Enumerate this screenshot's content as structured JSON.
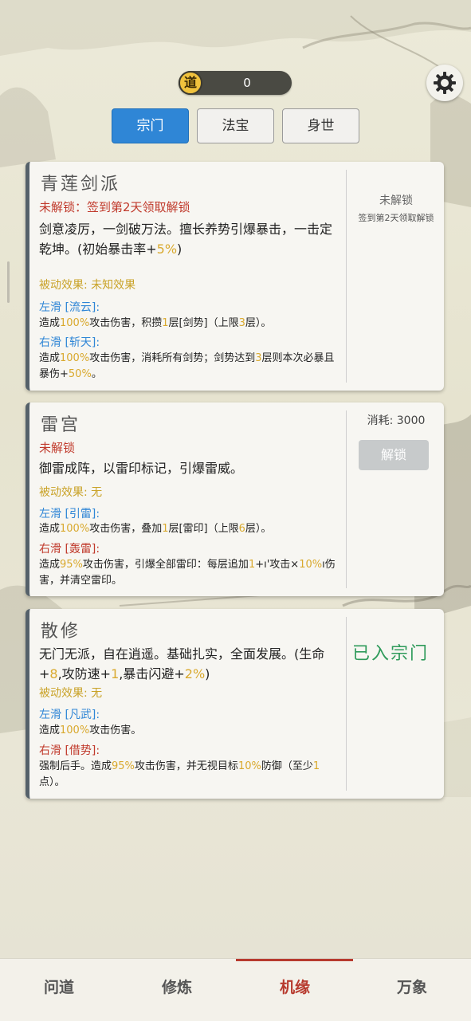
{
  "currency": {
    "icon_label": "道",
    "value": "0"
  },
  "tabs": [
    {
      "label": "宗门",
      "active": true
    },
    {
      "label": "法宝",
      "active": false
    },
    {
      "label": "身世",
      "active": false
    }
  ],
  "cards": [
    {
      "title": "青莲剑派",
      "status": "未解锁：签到第2天领取解锁",
      "desc_parts": [
        "剑意凌厉，一剑破万法。擅长养势引爆暴击，一击定乾坤。(初始暴击率+",
        "5%",
        ")"
      ],
      "passive": "被动效果: 未知效果",
      "left_skill": "左滑 [流云]:",
      "left_parts": [
        "造成",
        "100%",
        "攻击伤害，积攒",
        "1",
        "层[剑势]（上限",
        "3",
        "层）。"
      ],
      "right_skill": "右滑 [斩天]:",
      "right_parts": [
        "造成",
        "100%",
        "攻击伤害，消耗所有剑势；剑势达到",
        "3",
        "层则本次必暴且暴伤+",
        "50%",
        "。"
      ],
      "side_status": "未解锁",
      "side_note": "签到第2天领取解锁"
    },
    {
      "title": "雷宫",
      "status": "未解锁",
      "desc": "御雷成阵，以雷印标记，引爆雷威。",
      "passive": "被动效果: 无",
      "left_skill": "左滑 [引雷]:",
      "left_parts": [
        "造成",
        "100%",
        "攻击伤害，叠加",
        "1",
        "层[雷印]（上限",
        "6",
        "层）。"
      ],
      "right_skill": "右滑 [轰雷]:",
      "right_parts": [
        "造成",
        "95%",
        "攻击伤害，引爆全部雷印：每层追加",
        "1",
        "+ı'攻击×",
        "10%",
        "ı伤害，并清空雷印。"
      ],
      "cost": "消耗: 3000",
      "unlock_button": "解锁"
    },
    {
      "title": "散修",
      "desc_parts": [
        "无门无派，自在逍遥。基础扎实，全面发展。(生命+",
        "8",
        ",攻防速+",
        "1",
        ",暴击闪避+",
        "2%",
        ")"
      ],
      "passive": "被动效果: 无",
      "left_skill": "左滑 [凡武]:",
      "left_parts": [
        "造成",
        "100%",
        "攻击伤害。"
      ],
      "right_skill": "右滑 [借势]:",
      "right_parts": [
        "强制后手。造成",
        "95%",
        "攻击伤害，并无视目标",
        "10%",
        "防御（至少",
        "1",
        "点）。"
      ],
      "joined_label": "已入宗门"
    }
  ],
  "bottom_nav": [
    {
      "label": "问道",
      "active": false
    },
    {
      "label": "修炼",
      "active": false
    },
    {
      "label": "机缘",
      "active": true
    },
    {
      "label": "万象",
      "active": false
    }
  ],
  "colors": {
    "accent_blue": "#2f86d6",
    "status_red": "#c0392b",
    "highlight_gold": "#d9a92e",
    "joined_green": "#2e9a5a"
  }
}
